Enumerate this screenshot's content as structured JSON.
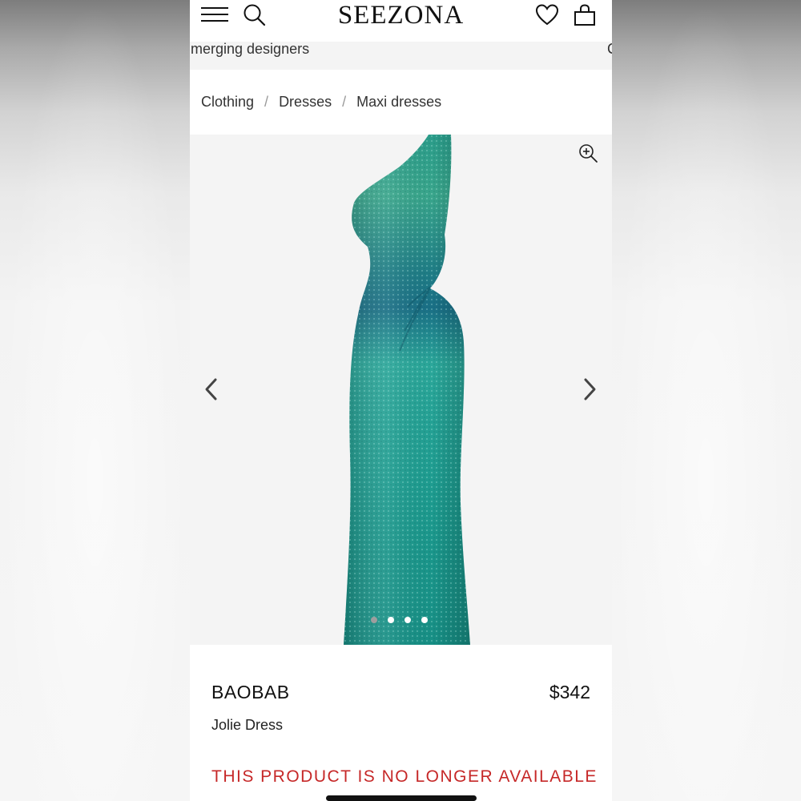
{
  "header": {
    "logo": "SEEZONA",
    "menu_icon": "hamburger-menu-icon",
    "search_icon": "search-icon",
    "wishlist_icon": "heart-icon",
    "bag_icon": "shopping-bag-icon"
  },
  "marquee": {
    "text": "merging designers",
    "tail": "C"
  },
  "breadcrumb": {
    "items": [
      "Clothing",
      "Dresses",
      "Maxi dresses"
    ],
    "separator": "/"
  },
  "gallery": {
    "zoom_icon": "zoom-in-icon",
    "prev_icon": "chevron-left-icon",
    "next_icon": "chevron-right-icon",
    "total_images": 4,
    "active_index": 0,
    "image_subject": "teal sequin one-shoulder maxi dress"
  },
  "product": {
    "brand": "BAOBAB",
    "price": "$342",
    "name": "Jolie Dress",
    "availability": "THIS PRODUCT IS NO LONGER AVAILABLE"
  },
  "colors": {
    "accent_red": "#c62828",
    "dress_teal": "#1e9e90",
    "dot_active": "#9e9e9e",
    "dot_inactive": "#ffffff"
  }
}
